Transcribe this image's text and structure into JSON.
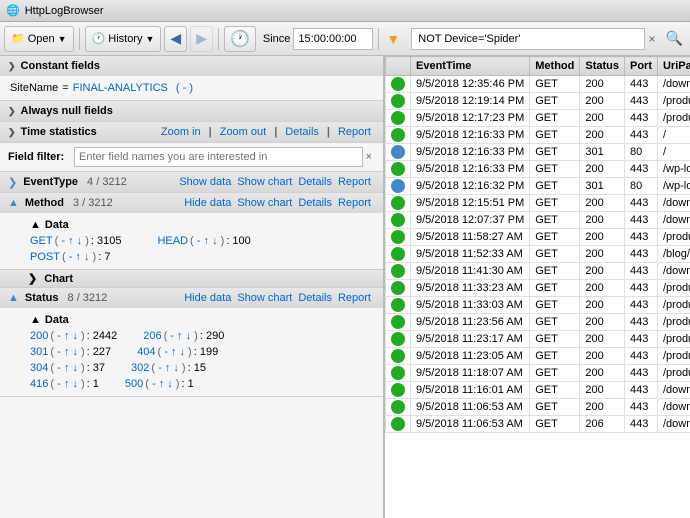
{
  "titleBar": {
    "text": "HttpLogBrowser"
  },
  "toolbar": {
    "openLabel": "Open",
    "historyLabel": "History",
    "backTitle": "Back",
    "forwardTitle": "Forward",
    "clockTitle": "Clock",
    "sinceLabel": "Since",
    "sinceValue": "15:00:00:00",
    "filterPlaceholder": "NOT Device='Spider'",
    "clearLabel": "×",
    "searchTitle": "Search"
  },
  "leftPanel": {
    "constantFields": {
      "header": "Constant fields",
      "siteName": "SiteName",
      "equals": " = ",
      "siteValue": "FINAL-ANALYTICS",
      "dashLink": "( - )"
    },
    "alwaysNullFields": {
      "header": "Always null fields"
    },
    "timeStatistics": {
      "header": "Time statistics",
      "zoomIn": "Zoom in",
      "zoomOut": "Zoom out",
      "details": "Details",
      "report": "Report"
    },
    "fieldFilter": {
      "label": "Field filter:",
      "placeholder": "Enter field names you are interested in",
      "clear": "×"
    },
    "eventType": {
      "name": "EventType",
      "count": "4 / 3212",
      "showData": "Show data",
      "showChart": "Show chart",
      "details": "Details",
      "report": "Report"
    },
    "method": {
      "name": "Method",
      "count": "3 / 3212",
      "hideData": "Hide data",
      "showChart": "Show chart",
      "details": "Details",
      "report": "Report",
      "dataItems": [
        {
          "label": "GET",
          "links": "( - ↑ ↓ )",
          "count": "3105"
        },
        {
          "label": "HEAD",
          "links": "( - ↑ ↓ )",
          "count": "100"
        },
        {
          "label": "POST",
          "links": "( - ↑ ↓ )",
          "count": "7"
        }
      ],
      "chartLabel": "Chart"
    },
    "status": {
      "name": "Status",
      "count": "8 / 3212",
      "hideData": "Hide data",
      "showChart": "Show chart",
      "details": "Details",
      "report": "Report",
      "dataItems": [
        {
          "label": "200",
          "links": "( - ↑ ↓ )",
          "count": "2442"
        },
        {
          "label": "206",
          "links": "( - ↑ ↓ )",
          "count": "290"
        },
        {
          "label": "301",
          "links": "( - ↑ ↓ )",
          "count": "227"
        },
        {
          "label": "404",
          "links": "( - ↑ ↓ )",
          "count": "199"
        },
        {
          "label": "304",
          "links": "( - ↑ ↓ )",
          "count": "37"
        },
        {
          "label": "302",
          "links": "( - ↑ ↓ )",
          "count": "15"
        },
        {
          "label": "416",
          "links": "( - ↑ ↓ )",
          "count": "1"
        },
        {
          "label": "500",
          "links": "( - ↑ ↓ )",
          "count": "1"
        }
      ]
    }
  },
  "rightPanel": {
    "columns": [
      "",
      "EventTime",
      "Method",
      "Status",
      "Port",
      "UriPath"
    ],
    "rows": [
      {
        "icon": "green",
        "time": "9/5/2018 12:35:46 PM",
        "method": "GET",
        "status": "200",
        "port": "443",
        "path": "/down"
      },
      {
        "icon": "green",
        "time": "9/5/2018 12:19:14 PM",
        "method": "GET",
        "status": "200",
        "port": "443",
        "path": "/produ"
      },
      {
        "icon": "green",
        "time": "9/5/2018 12:17:23 PM",
        "method": "GET",
        "status": "200",
        "port": "443",
        "path": "/produ"
      },
      {
        "icon": "green",
        "time": "9/5/2018 12:16:33 PM",
        "method": "GET",
        "status": "200",
        "port": "443",
        "path": "/"
      },
      {
        "icon": "blue",
        "time": "9/5/2018 12:16:33 PM",
        "method": "GET",
        "status": "301",
        "port": "80",
        "path": "/"
      },
      {
        "icon": "green",
        "time": "9/5/2018 12:16:33 PM",
        "method": "GET",
        "status": "200",
        "port": "443",
        "path": "/wp-lo"
      },
      {
        "icon": "blue",
        "time": "9/5/2018 12:16:32 PM",
        "method": "GET",
        "status": "301",
        "port": "80",
        "path": "/wp-lo"
      },
      {
        "icon": "green",
        "time": "9/5/2018 12:15:51 PM",
        "method": "GET",
        "status": "200",
        "port": "443",
        "path": "/down"
      },
      {
        "icon": "green",
        "time": "9/5/2018 12:07:37 PM",
        "method": "GET",
        "status": "200",
        "port": "443",
        "path": "/down"
      },
      {
        "icon": "green",
        "time": "9/5/2018 11:58:27 AM",
        "method": "GET",
        "status": "200",
        "port": "443",
        "path": "/produ"
      },
      {
        "icon": "green",
        "time": "9/5/2018 11:52:33 AM",
        "method": "GET",
        "status": "200",
        "port": "443",
        "path": "/blog/m"
      },
      {
        "icon": "green",
        "time": "9/5/2018 11:41:30 AM",
        "method": "GET",
        "status": "200",
        "port": "443",
        "path": "/down"
      },
      {
        "icon": "green",
        "time": "9/5/2018 11:33:23 AM",
        "method": "GET",
        "status": "200",
        "port": "443",
        "path": "/produ"
      },
      {
        "icon": "green",
        "time": "9/5/2018 11:33:03 AM",
        "method": "GET",
        "status": "200",
        "port": "443",
        "path": "/produ"
      },
      {
        "icon": "green",
        "time": "9/5/2018 11:23:56 AM",
        "method": "GET",
        "status": "200",
        "port": "443",
        "path": "/produ"
      },
      {
        "icon": "green",
        "time": "9/5/2018 11:23:17 AM",
        "method": "GET",
        "status": "200",
        "port": "443",
        "path": "/produ"
      },
      {
        "icon": "green",
        "time": "9/5/2018 11:23:05 AM",
        "method": "GET",
        "status": "200",
        "port": "443",
        "path": "/produ"
      },
      {
        "icon": "green",
        "time": "9/5/2018 11:18:07 AM",
        "method": "GET",
        "status": "200",
        "port": "443",
        "path": "/produ"
      },
      {
        "icon": "green",
        "time": "9/5/2018 11:16:01 AM",
        "method": "GET",
        "status": "200",
        "port": "443",
        "path": "/down"
      },
      {
        "icon": "green",
        "time": "9/5/2018 11:06:53 AM",
        "method": "GET",
        "status": "200",
        "port": "443",
        "path": "/down"
      },
      {
        "icon": "green",
        "time": "9/5/2018 11:06:53 AM",
        "method": "GET",
        "status": "206",
        "port": "443",
        "path": "/down"
      }
    ]
  }
}
